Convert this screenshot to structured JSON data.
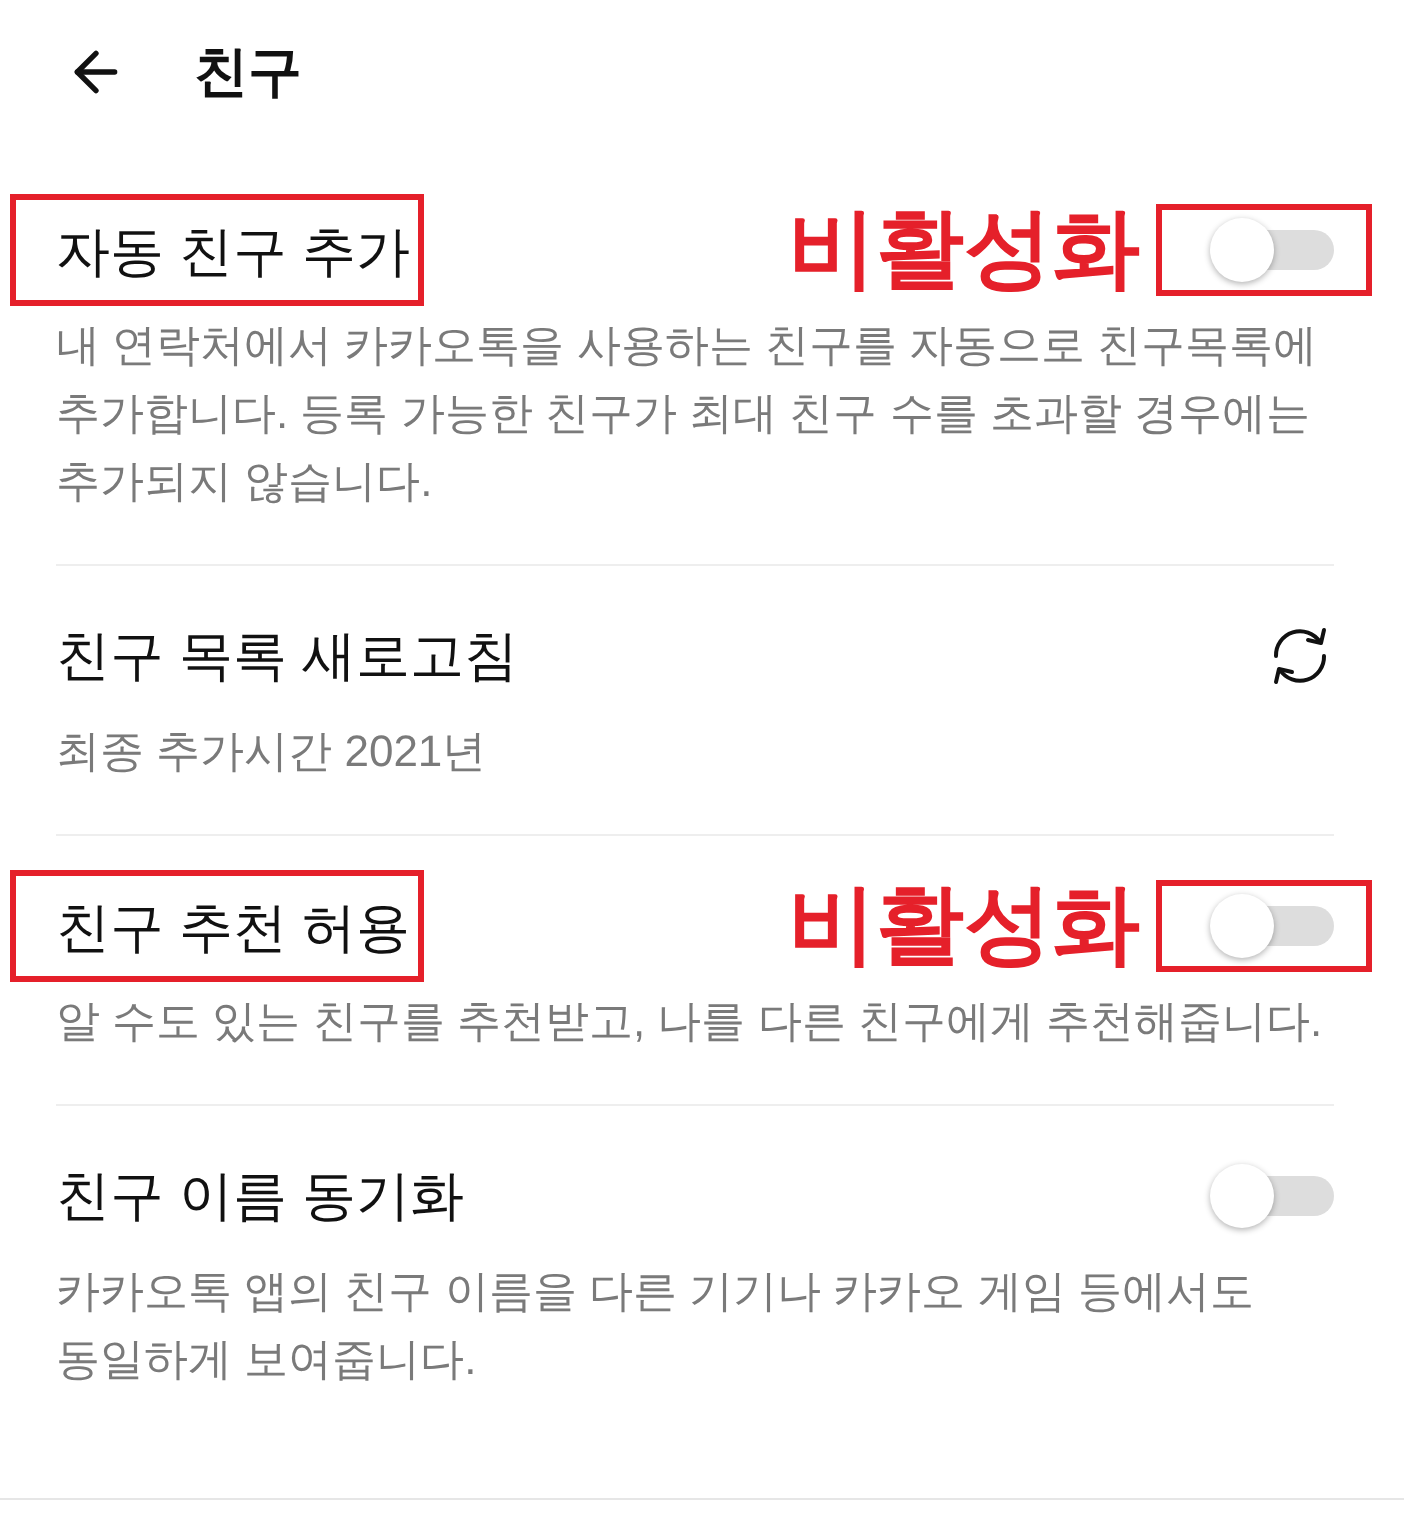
{
  "header": {
    "title": "친구"
  },
  "settings": [
    {
      "kind": "toggle",
      "title": "자동 친구 추가",
      "description": "내 연락처에서 카카오톡을 사용하는 친구를 자동으로 친구목록에 추가합니다. 등록 가능한 친구가 최대 친구 수를 초과할 경우에는 추가되지 않습니다.",
      "on": false,
      "highlighted": true,
      "annotation": "비활성화"
    },
    {
      "kind": "refresh",
      "title": "친구 목록 새로고침",
      "description": "최종 추가시간 2021년",
      "highlighted": false
    },
    {
      "kind": "toggle",
      "title": "친구 추천 허용",
      "description": "알 수도 있는 친구를 추천받고, 나를 다른 친구에게 추천해줍니다.",
      "on": false,
      "highlighted": true,
      "annotation": "비활성화"
    },
    {
      "kind": "toggle",
      "title": "친구 이름 동기화",
      "description": "카카오톡 앱의 친구 이름을 다른 기기나 카카오 게임 등에서도 동일하게 보여줍니다.",
      "on": false,
      "highlighted": false
    }
  ]
}
